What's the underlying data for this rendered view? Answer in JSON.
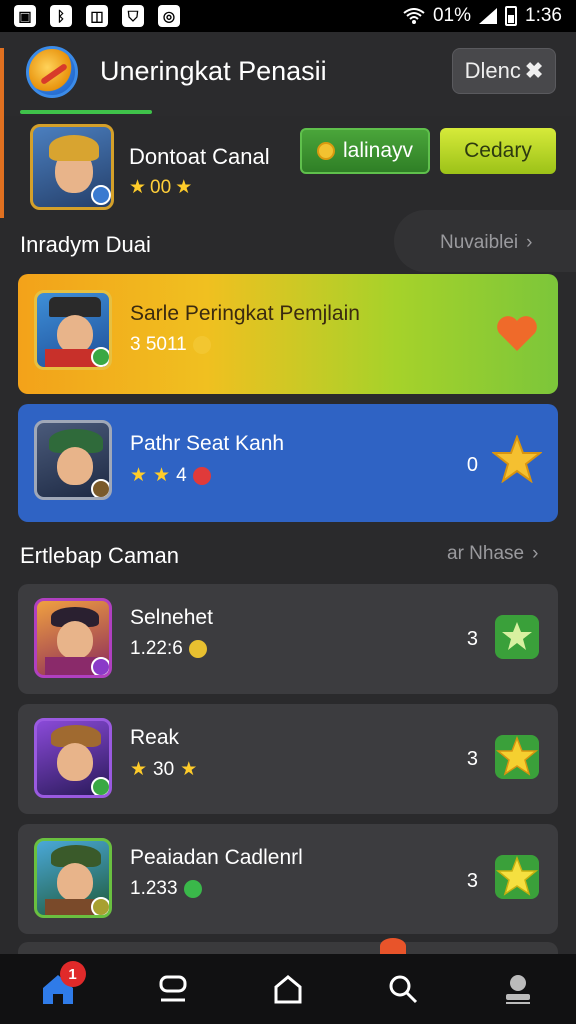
{
  "status_bar": {
    "icons": [
      "image-icon",
      "bluetooth-icon",
      "nfc-icon",
      "shield-icon",
      "instagram-icon"
    ],
    "battery_text": "01%",
    "time": "1:36"
  },
  "header": {
    "title": "Uneringkat Penasii",
    "button_label": "Dlenc",
    "accent_color": "#3fc24a"
  },
  "profile": {
    "name": "Dontoat Canal",
    "score": "00",
    "primary_button": "lalinayv",
    "secondary_button": "Cedary"
  },
  "section1": {
    "title": "Inradym Duai",
    "link": "Nuvaiblei"
  },
  "featured": [
    {
      "title": "Sarle Peringkat Pemjlain",
      "sub": "3 5011",
      "rank": "",
      "color": "gradient-orange-green",
      "icon": "heart-icon"
    },
    {
      "title": "Pathr Seat Kanh",
      "sub": "4",
      "rank": "0",
      "color": "#2f63c4",
      "icon": "star-icon"
    }
  ],
  "section2": {
    "title": "Ertlebap Caman",
    "link": "ar Nhase"
  },
  "list": [
    {
      "title": "Selnehet",
      "sub": "1.22:6",
      "rank": "3"
    },
    {
      "title": "Reak",
      "sub": "30",
      "rank": "3"
    },
    {
      "title": "Peaiadan Cadlenrl",
      "sub": "1.233",
      "rank": "3"
    }
  ],
  "nav": {
    "items": [
      "home-icon",
      "chat-icon",
      "house-icon",
      "search-icon",
      "profile-icon"
    ],
    "notification_count": "1"
  }
}
